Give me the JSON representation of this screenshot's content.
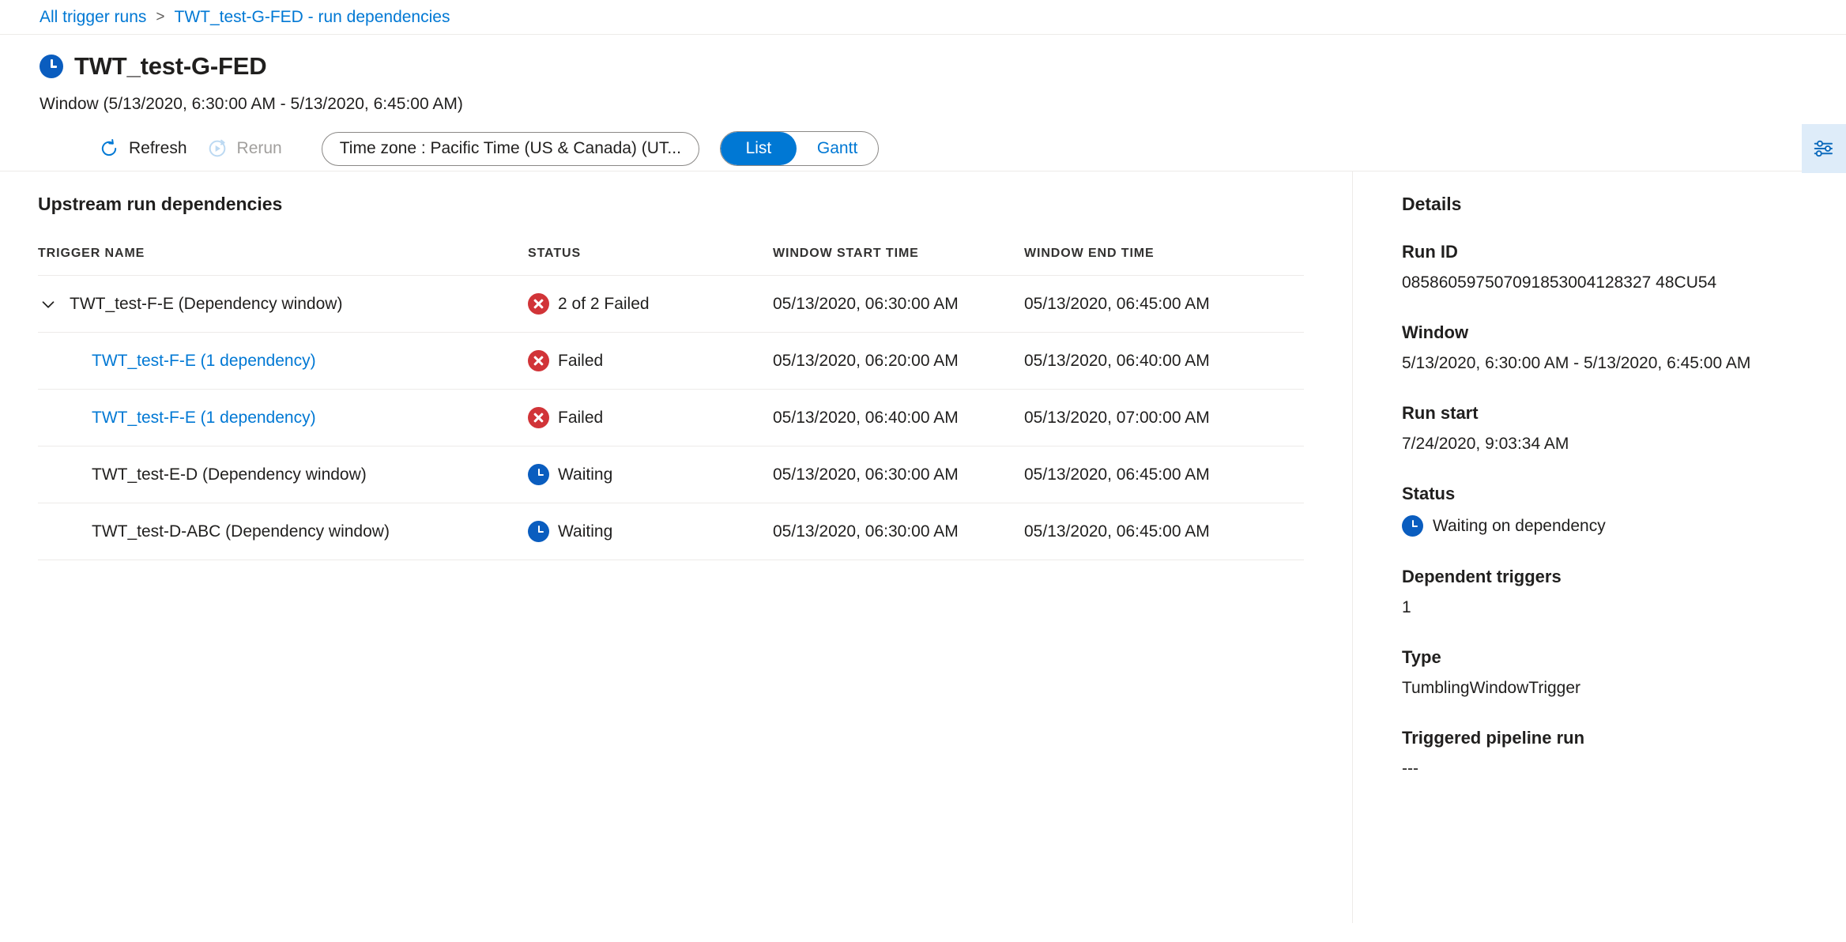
{
  "breadcrumb": {
    "items": [
      {
        "label": "All trigger runs"
      },
      {
        "label": "TWT_test-G-FED - run dependencies"
      }
    ],
    "separator": ">"
  },
  "header": {
    "status_icon": "clock-icon",
    "title": "TWT_test-G-FED",
    "window_subtitle": "Window (5/13/2020, 6:30:00 AM - 5/13/2020, 6:45:00 AM)"
  },
  "toolbar": {
    "refresh_label": "Refresh",
    "refresh_icon": "refresh-icon",
    "rerun_label": "Rerun",
    "rerun_icon": "rerun-icon",
    "rerun_disabled": true,
    "timezone_label": "Time zone : Pacific Time (US & Canada) (UT...",
    "view_options": [
      {
        "label": "List",
        "active": true
      },
      {
        "label": "Gantt",
        "active": false
      }
    ],
    "settings_icon": "settings-sliders-icon"
  },
  "main": {
    "section_title": "Upstream run dependencies",
    "columns": [
      "TRIGGER NAME",
      "STATUS",
      "WINDOW START TIME",
      "WINDOW END TIME"
    ],
    "rows": [
      {
        "name": "TWT_test-F-E (Dependency window)",
        "status": "2 of 2 Failed",
        "status_type": "failed",
        "window_start": "05/13/2020, 06:30:00 AM",
        "window_end": "05/13/2020, 06:45:00 AM",
        "expandable": true,
        "expanded": true,
        "child": false,
        "link": false
      },
      {
        "name": "TWT_test-F-E (1 dependency)",
        "status": "Failed",
        "status_type": "failed",
        "window_start": "05/13/2020, 06:20:00 AM",
        "window_end": "05/13/2020, 06:40:00 AM",
        "expandable": false,
        "expanded": false,
        "child": true,
        "link": true
      },
      {
        "name": "TWT_test-F-E (1 dependency)",
        "status": "Failed",
        "status_type": "failed",
        "window_start": "05/13/2020, 06:40:00 AM",
        "window_end": "05/13/2020, 07:00:00 AM",
        "expandable": false,
        "expanded": false,
        "child": true,
        "link": true
      },
      {
        "name": "TWT_test-E-D (Dependency window)",
        "status": "Waiting",
        "status_type": "waiting",
        "window_start": "05/13/2020, 06:30:00 AM",
        "window_end": "05/13/2020, 06:45:00 AM",
        "expandable": false,
        "expanded": false,
        "child": true,
        "link": false
      },
      {
        "name": "TWT_test-D-ABC (Dependency window)",
        "status": "Waiting",
        "status_type": "waiting",
        "window_start": "05/13/2020, 06:30:00 AM",
        "window_end": "05/13/2020, 06:45:00 AM",
        "expandable": false,
        "expanded": false,
        "child": true,
        "link": false
      }
    ]
  },
  "details": {
    "title": "Details",
    "fields": [
      {
        "label": "Run ID",
        "value": "085860597507091853004128327 48CU54",
        "icon": null
      },
      {
        "label": "Window",
        "value": "5/13/2020, 6:30:00 AM - 5/13/2020, 6:45:00 AM",
        "icon": null
      },
      {
        "label": "Run start",
        "value": "7/24/2020, 9:03:34 AM",
        "icon": null
      },
      {
        "label": "Status",
        "value": "Waiting on dependency",
        "icon": "clock-icon"
      },
      {
        "label": "Dependent triggers",
        "value": "1",
        "icon": null
      },
      {
        "label": "Type",
        "value": "TumblingWindowTrigger",
        "icon": null
      },
      {
        "label": "Triggered pipeline run",
        "value": "---",
        "icon": null
      }
    ]
  },
  "colors": {
    "accent": "#0078d4",
    "failed": "#d13438",
    "waiting": "#0a5dbf",
    "divider": "#edebe9",
    "settings_bg": "#deecf9"
  }
}
